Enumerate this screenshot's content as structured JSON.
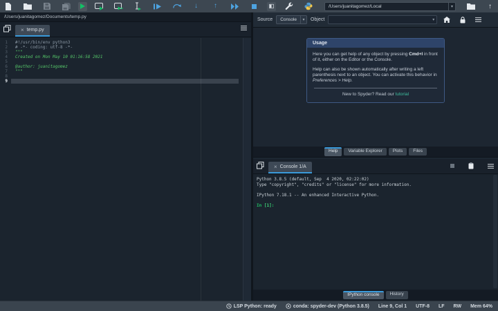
{
  "toolbar": {
    "working_dir": "/Users/juanitagomez/Local",
    "icon_names": [
      "new-file",
      "open-file",
      "save",
      "save-all",
      "run",
      "run-cell",
      "run-cell-advance",
      "run-selection",
      "debug-file",
      "step-over",
      "step-into",
      "step-out",
      "continue",
      "stop-debug",
      "maximize-pane",
      "preferences",
      "python-path-manager",
      "browse-working-directory",
      "parent-directory"
    ]
  },
  "glyphs": {
    "dropdown": "▾",
    "close": "×",
    "up_arrow": "↑",
    "down_arrow": "↓"
  },
  "editor": {
    "breadcrumb": "/Users/juanitagomez/Documents/temp.py",
    "tab_label": "temp.py",
    "lines": [
      {
        "n": "1",
        "text": "#!/usr/bin/env python3"
      },
      {
        "n": "2",
        "text": "# -*- coding: utf-8 -*-"
      },
      {
        "n": "3",
        "text": "\"\"\""
      },
      {
        "n": "4",
        "text": "Created on Mon May 10 01:16:58 2021"
      },
      {
        "n": "5",
        "text": ""
      },
      {
        "n": "6",
        "text": "@author: juanitagomez"
      },
      {
        "n": "7",
        "text": "\"\"\""
      },
      {
        "n": "8",
        "text": ""
      },
      {
        "n": "9",
        "text": ""
      }
    ]
  },
  "help": {
    "source_label": "Source",
    "source_value": "Console",
    "object_label": "Object",
    "object_value": "",
    "usage": {
      "title": "Usage",
      "p1_pre": "Here you can get help of any object by pressing ",
      "p1_bold": "Cmd+I",
      "p1_post": " in front of it, either on the Editor or the Console.",
      "p2_pre": "Help can also be shown automatically after writing a left parenthesis next to an object. You can activate this behavior in ",
      "p2_italic": "Preferences > Help",
      "p2_post": ".",
      "footer_pre": "New to Spyder? Read our ",
      "footer_link": "tutorial"
    },
    "tabs": [
      {
        "label": "Help"
      },
      {
        "label": "Variable Explorer"
      },
      {
        "label": "Plots"
      },
      {
        "label": "Files"
      }
    ]
  },
  "console": {
    "tab_label": "Console 1/A",
    "banner": [
      "Python 3.8.5 (default, Sep  4 2020, 02:22:02)",
      "Type \"copyright\", \"credits\" or \"license\" for more information.",
      "",
      "IPython 7.18.1 -- An enhanced Interactive Python.",
      ""
    ],
    "prompt": {
      "in_word": "In ",
      "number": "[1]",
      "colon": ":"
    },
    "bottom_tabs": [
      {
        "label": "IPython console"
      },
      {
        "label": "History"
      }
    ]
  },
  "statusbar": {
    "lsp": "LSP Python: ready",
    "conda": "conda: spyder-dev (Python 3.8.5)",
    "cursor": "Line 9, Col 1",
    "encoding": "UTF-8",
    "eol": "LF",
    "rw": "RW",
    "mem": "Mem 64%"
  },
  "colors": {
    "accent_blue": "#3a9bdc",
    "run_green": "#13bf66",
    "debug_blue": "#4da3e0",
    "link_teal": "#3fbf9f",
    "docstring_green": "#56c86a",
    "comment_gray": "#8c99a6",
    "toolbar_bg": "#3d4751",
    "editor_bg": "#1b242e"
  }
}
